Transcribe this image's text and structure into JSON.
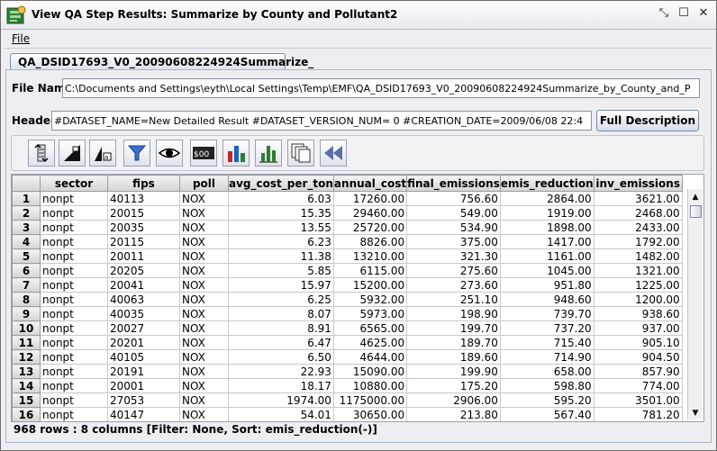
{
  "window": {
    "title": "View QA Step Results: Summarize by County and Pollutant2"
  },
  "menu": {
    "file": "File"
  },
  "tab": {
    "label": "QA_DSID17693_V0_20090608224924Summarize_"
  },
  "file_name": {
    "label": "File Name",
    "value": "C:\\Documents and Settings\\eyth\\Local Settings\\Temp\\EMF\\QA_DSID17693_V0_20090608224924Summarize_by_County_and_P"
  },
  "header": {
    "label": "Header",
    "value": "#DATASET_NAME=New Detailed Result #DATASET_VERSION_NUM= 0 #CREATION_DATE=2009/06/08 22:4",
    "button": "Full Description"
  },
  "toolbar": {
    "icons": [
      "sort-icon",
      "format-icon",
      "font-icon",
      "filter-icon",
      "view-icon",
      "currency-format-icon",
      "bar-chart-icon",
      "chart-icon",
      "copy-icon",
      "rewind-icon"
    ],
    "currency_text": "$00"
  },
  "table": {
    "columns": [
      "sector",
      "fips",
      "poll",
      "avg_cost_per_ton",
      "annual_cost",
      "final_emissions",
      "emis_reduction",
      "inv_emissions"
    ],
    "rows": [
      [
        "1",
        "nonpt",
        "40113",
        "NOX",
        "6.03",
        "17260.00",
        "756.60",
        "2864.00",
        "3621.00"
      ],
      [
        "2",
        "nonpt",
        "20015",
        "NOX",
        "15.35",
        "29460.00",
        "549.00",
        "1919.00",
        "2468.00"
      ],
      [
        "3",
        "nonpt",
        "20035",
        "NOX",
        "13.55",
        "25720.00",
        "534.90",
        "1898.00",
        "2433.00"
      ],
      [
        "4",
        "nonpt",
        "20115",
        "NOX",
        "6.23",
        "8826.00",
        "375.00",
        "1417.00",
        "1792.00"
      ],
      [
        "5",
        "nonpt",
        "20011",
        "NOX",
        "11.38",
        "13210.00",
        "321.30",
        "1161.00",
        "1482.00"
      ],
      [
        "6",
        "nonpt",
        "20205",
        "NOX",
        "5.85",
        "6115.00",
        "275.60",
        "1045.00",
        "1321.00"
      ],
      [
        "7",
        "nonpt",
        "20041",
        "NOX",
        "15.97",
        "15200.00",
        "273.60",
        "951.80",
        "1225.00"
      ],
      [
        "8",
        "nonpt",
        "40063",
        "NOX",
        "6.25",
        "5932.00",
        "251.10",
        "948.60",
        "1200.00"
      ],
      [
        "9",
        "nonpt",
        "40035",
        "NOX",
        "8.07",
        "5973.00",
        "198.90",
        "739.70",
        "938.60"
      ],
      [
        "10",
        "nonpt",
        "20027",
        "NOX",
        "8.91",
        "6565.00",
        "199.70",
        "737.20",
        "937.00"
      ],
      [
        "11",
        "nonpt",
        "20201",
        "NOX",
        "6.47",
        "4625.00",
        "189.70",
        "715.40",
        "905.10"
      ],
      [
        "12",
        "nonpt",
        "40105",
        "NOX",
        "6.50",
        "4644.00",
        "189.60",
        "714.90",
        "904.50"
      ],
      [
        "13",
        "nonpt",
        "20191",
        "NOX",
        "22.93",
        "15090.00",
        "199.90",
        "658.00",
        "857.90"
      ],
      [
        "14",
        "nonpt",
        "20001",
        "NOX",
        "18.17",
        "10880.00",
        "175.20",
        "598.80",
        "774.00"
      ],
      [
        "15",
        "nonpt",
        "27053",
        "NOX",
        "1974.00",
        "1175000.00",
        "2906.00",
        "595.20",
        "3501.00"
      ],
      [
        "16",
        "nonpt",
        "40147",
        "NOX",
        "54.01",
        "30650.00",
        "213.80",
        "567.40",
        "781.20"
      ]
    ]
  },
  "status": {
    "text": "968 rows : 8 columns [Filter: None, Sort: emis_reduction(-)]"
  }
}
